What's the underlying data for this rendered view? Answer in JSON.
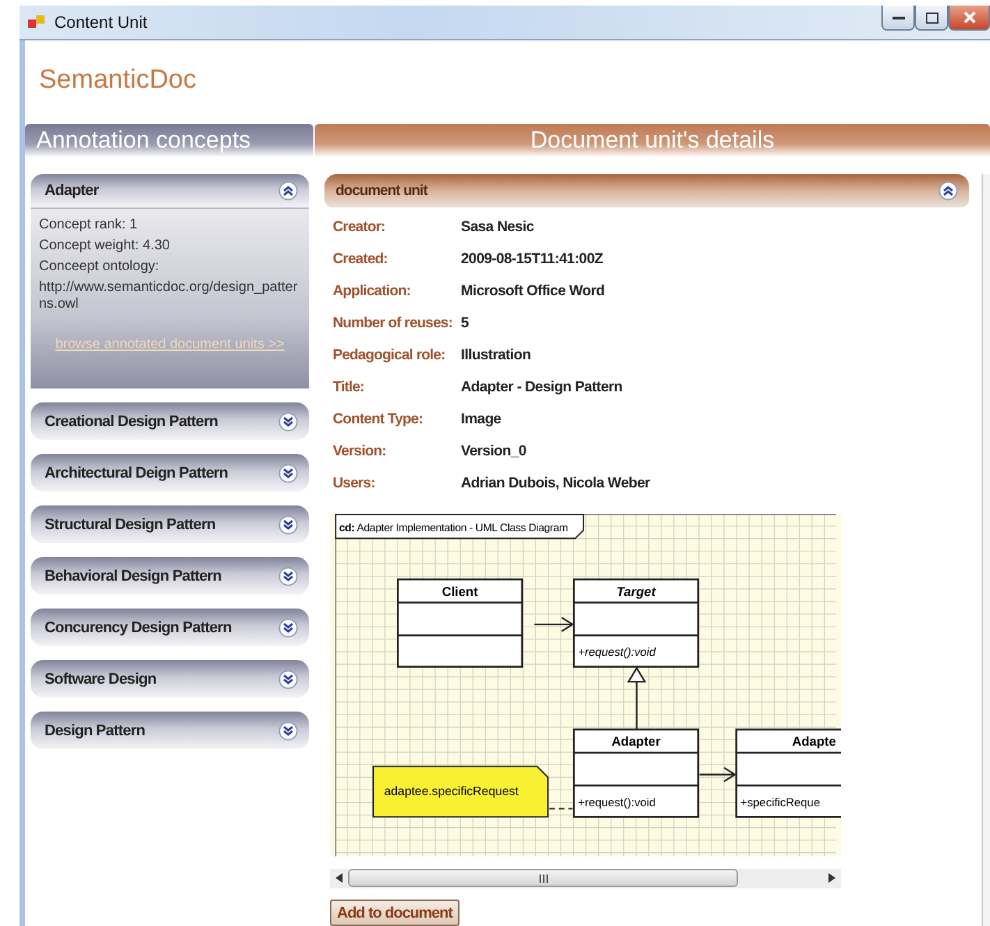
{
  "window": {
    "title": "Content Unit"
  },
  "app_title": "SemanticDoc",
  "left_header": "Annotation concepts",
  "right_header": "Document unit's details",
  "concepts": [
    {
      "label": "Adapter",
      "expanded": true,
      "details": [
        "Concept rank: 1",
        "Concept weight: 4.30",
        "Conceept ontology:",
        "http://www.semanticdoc.org/design_patterns.owl"
      ],
      "link": "browse annotated document units >>"
    },
    {
      "label": "Creational Design Pattern",
      "expanded": false
    },
    {
      "label": "Architectural Deign Pattern",
      "expanded": false
    },
    {
      "label": "Structural Design Pattern",
      "expanded": false
    },
    {
      "label": "Behavioral Design Pattern",
      "expanded": false
    },
    {
      "label": "Concurency Design Pattern",
      "expanded": false
    },
    {
      "label": "Software Design",
      "expanded": false
    },
    {
      "label": "Design Pattern",
      "expanded": false
    }
  ],
  "document_unit": {
    "title": "document unit",
    "expanded": true,
    "fields": [
      {
        "label": "Creator:",
        "value": "Sasa Nesic"
      },
      {
        "label": "Created:",
        "value": "2009-08-15T11:41:00Z"
      },
      {
        "label": "Application:",
        "value": "Microsoft Office Word"
      },
      {
        "label": "Number of reuses:",
        "value": "5"
      },
      {
        "label": "Pedagogical role:",
        "value": "Illustration"
      },
      {
        "label": "Title:",
        "value": "Adapter - Design Pattern"
      },
      {
        "label": "Content Type:",
        "value": "Image"
      },
      {
        "label": "Version:",
        "value": "Version_0"
      },
      {
        "label": "Users:",
        "value": "Adrian Dubois, Nicola Weber"
      }
    ]
  },
  "diagram": {
    "frame_prefix": "cd:",
    "frame_title": "Adapter Implementation - UML Class Diagram",
    "classes": [
      {
        "name": "Client",
        "abstract": false
      },
      {
        "name": "Target",
        "abstract": true,
        "operation": "+request():void"
      },
      {
        "name": "Adapter",
        "abstract": false,
        "operation": "+request():void"
      },
      {
        "name": "Adapte",
        "abstract": false,
        "operation": "+specificReque"
      }
    ],
    "note": "adaptee.specificRequest"
  },
  "button": "Add to document"
}
